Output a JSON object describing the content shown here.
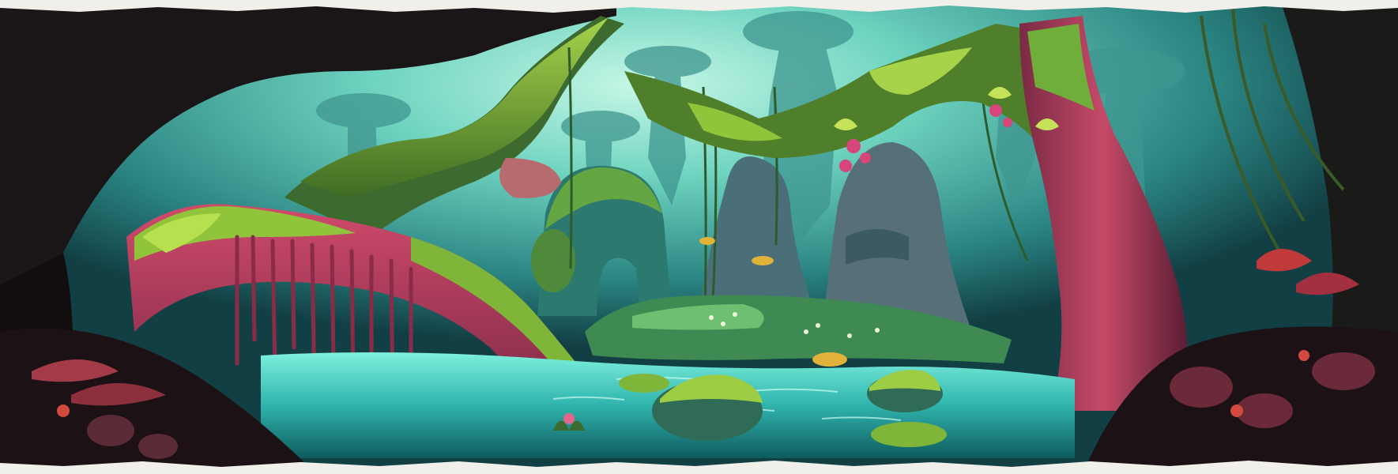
{
  "scene": {
    "subject": "fantasy-jungle-pond-concept-art",
    "palette": {
      "sky_glow": "#8fe8d0",
      "distant_trees": "#4aa39a",
      "mid_teal": "#2f8a86",
      "deep_teal": "#175f63",
      "moss_bright": "#8fc43b",
      "moss_dark": "#4f7f2a",
      "magenta_bark": "#b53c5e",
      "magenta_dark": "#6e2440",
      "water": "#3fd1c2",
      "water_deep": "#12706e",
      "foreground_dark": "#150e12",
      "border_white": "#f1efea"
    },
    "border": "white-torn-top-and-bottom-edges",
    "icons": [
      "mushroom-icon",
      "flower-icon",
      "leaf-icon"
    ]
  }
}
